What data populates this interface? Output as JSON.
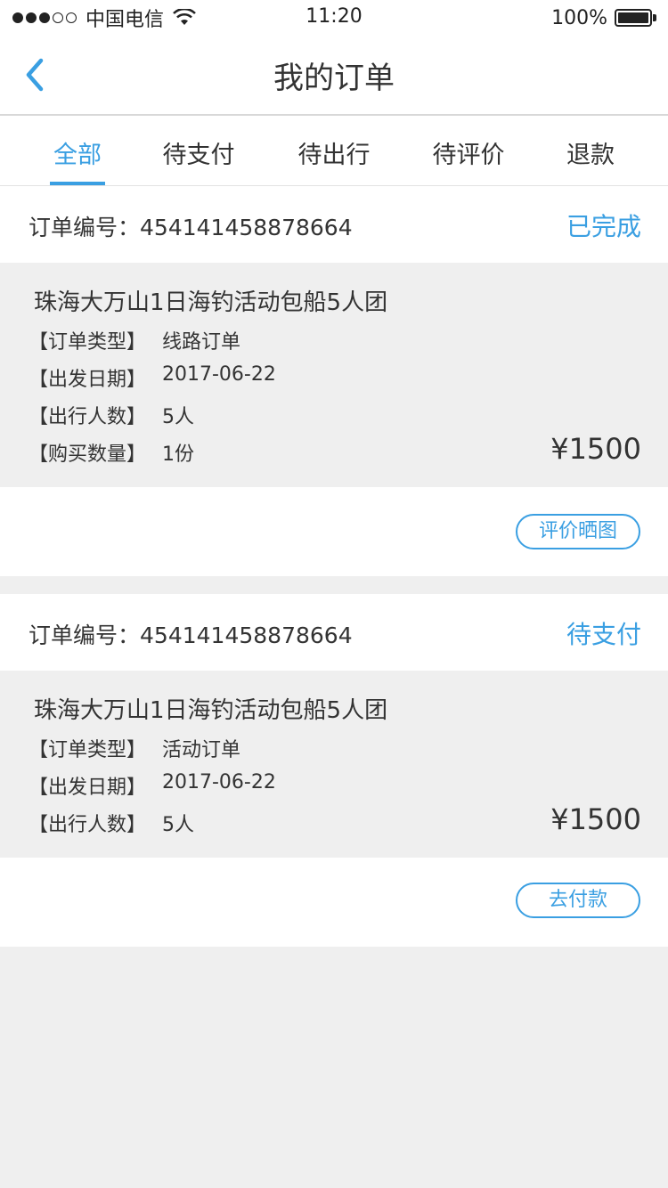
{
  "status_bar": {
    "carrier": "中国电信",
    "time": "11:20",
    "battery": "100%"
  },
  "nav": {
    "title": "我的订单"
  },
  "tabs": [
    {
      "label": "全部",
      "active": true
    },
    {
      "label": "待支付",
      "active": false
    },
    {
      "label": "待出行",
      "active": false
    },
    {
      "label": "待评价",
      "active": false
    },
    {
      "label": "退款",
      "active": false
    }
  ],
  "colors": {
    "accent": "#3a9fe2",
    "background": "#efefef"
  },
  "orders": [
    {
      "order_label": "订单编号：",
      "order_no": "454141458878664",
      "status": "已完成",
      "product": "珠海大万山1日海钓活动包船5人团",
      "rows": [
        {
          "k": "【订单类型】",
          "v": "线路订单"
        },
        {
          "k": "【出发日期】",
          "v": "2017-06-22"
        },
        {
          "k": "【出行人数】",
          "v": "5人"
        },
        {
          "k": "【购买数量】",
          "v": "1份"
        }
      ],
      "price": "¥1500",
      "action": "评价晒图"
    },
    {
      "order_label": "订单编号：",
      "order_no": "454141458878664",
      "status": "待支付",
      "product": "珠海大万山1日海钓活动包船5人团",
      "rows": [
        {
          "k": "【订单类型】",
          "v": "活动订单"
        },
        {
          "k": "【出发日期】",
          "v": "2017-06-22"
        },
        {
          "k": "【出行人数】",
          "v": "5人"
        }
      ],
      "price": "¥1500",
      "action": "去付款"
    }
  ]
}
